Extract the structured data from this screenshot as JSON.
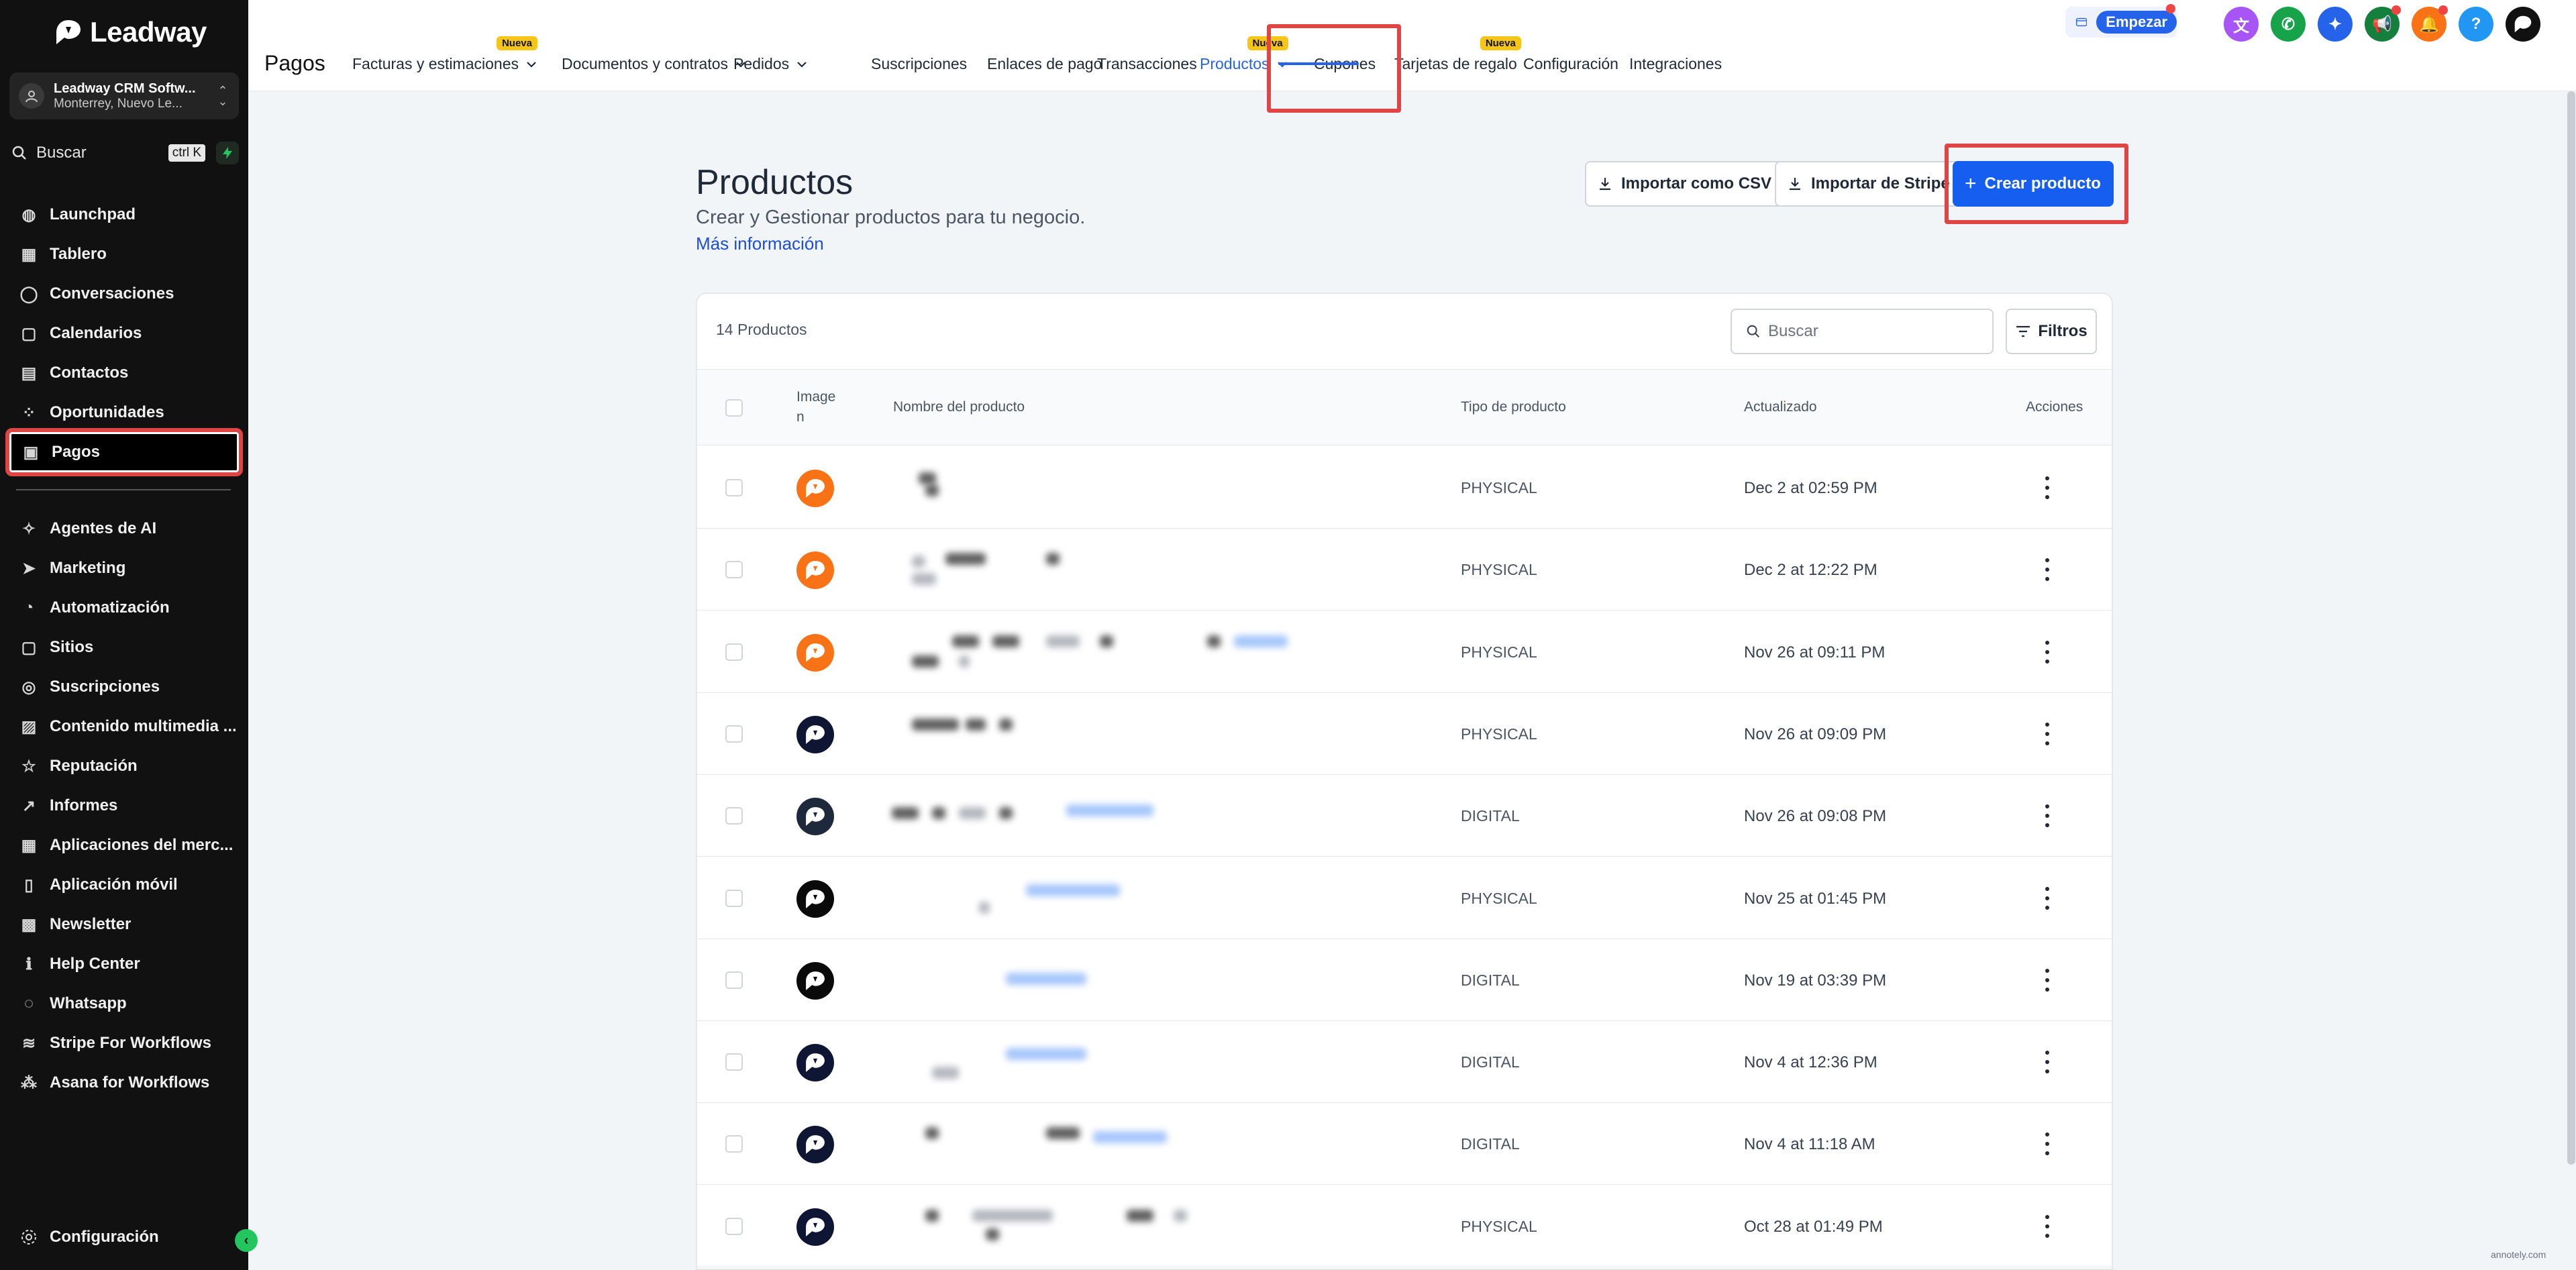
{
  "brand": {
    "name": "Leadway"
  },
  "account": {
    "name": "Leadway CRM Softw...",
    "location": "Monterrey, Nuevo Le..."
  },
  "search": {
    "label": "Buscar",
    "shortcut": "ctrl K"
  },
  "sidebar": {
    "items": [
      {
        "label": "Launchpad",
        "icon": "rocket-icon"
      },
      {
        "label": "Tablero",
        "icon": "grid-icon"
      },
      {
        "label": "Conversaciones",
        "icon": "chat-icon"
      },
      {
        "label": "Calendarios",
        "icon": "calendar-icon"
      },
      {
        "label": "Contactos",
        "icon": "contacts-icon"
      },
      {
        "label": "Oportunidades",
        "icon": "opportunities-icon"
      },
      {
        "label": "Pagos",
        "icon": "payments-icon",
        "active": true
      },
      {
        "label": "Agentes de AI",
        "icon": "sparkles-icon"
      },
      {
        "label": "Marketing",
        "icon": "send-icon"
      },
      {
        "label": "Automatización",
        "icon": "automation-icon"
      },
      {
        "label": "Sitios",
        "icon": "sites-icon"
      },
      {
        "label": "Suscripciones",
        "icon": "badge-icon"
      },
      {
        "label": "Contenido multimedia ...",
        "icon": "image-icon"
      },
      {
        "label": "Reputación",
        "icon": "star-icon"
      },
      {
        "label": "Informes",
        "icon": "trend-icon"
      },
      {
        "label": "Aplicaciones del merc...",
        "icon": "apps-icon"
      },
      {
        "label": "Aplicación móvil",
        "icon": "mobile-icon"
      },
      {
        "label": "Newsletter",
        "icon": "newsletter-icon"
      },
      {
        "label": "Help Center",
        "icon": "info-icon"
      },
      {
        "label": "Whatsapp",
        "icon": "whatsapp-icon"
      },
      {
        "label": "Stripe For Workflows",
        "icon": "stripe-icon"
      },
      {
        "label": "Asana for Workflows",
        "icon": "asana-icon"
      }
    ],
    "settings_label": "Configuración"
  },
  "header": {
    "section_title": "Pagos",
    "badge_label": "Nueva",
    "tabs": [
      {
        "label": "Facturas y estimaciones",
        "dropdown": true,
        "new": true
      },
      {
        "label": "Documentos y contratos",
        "dropdown": true
      },
      {
        "label": "Pedidos",
        "dropdown": true
      },
      {
        "label": "Suscripciones"
      },
      {
        "label": "Enlaces de pago"
      },
      {
        "label": "Transacciones"
      },
      {
        "label": "Productos",
        "dropdown": true,
        "new": true,
        "active": true
      },
      {
        "label": "Cupones"
      },
      {
        "label": "Tarjetas de regalo",
        "new": true
      },
      {
        "label": "Configuración"
      },
      {
        "label": "Integraciones"
      }
    ],
    "empezar_label": "Empezar"
  },
  "page": {
    "title": "Productos",
    "subtitle": "Crear y Gestionar productos para tu negocio.",
    "learn_more": "Más información",
    "import_csv": "Importar como CSV",
    "import_stripe": "Importar de Stripe",
    "create": "Crear producto"
  },
  "table": {
    "count_label": "14 Productos",
    "search_placeholder": "Buscar",
    "filters_label": "Filtros",
    "columns": {
      "image_1": "Image",
      "image_2": "n",
      "name": "Nombre del producto",
      "type": "Tipo de producto",
      "updated": "Actualizado",
      "actions": "Acciones"
    },
    "rows": [
      {
        "type": "PHYSICAL",
        "updated": "Dec 2 at 02:59 PM",
        "thumb_color": "#f97316"
      },
      {
        "type": "PHYSICAL",
        "updated": "Dec 2 at 12:22 PM",
        "thumb_color": "#f97316"
      },
      {
        "type": "PHYSICAL",
        "updated": "Nov 26 at 09:11 PM",
        "thumb_color": "#f97316"
      },
      {
        "type": "PHYSICAL",
        "updated": "Nov 26 at 09:09 PM",
        "thumb_color": "#0f1633"
      },
      {
        "type": "DIGITAL",
        "updated": "Nov 26 at 09:08 PM",
        "thumb_color": "#1e293b"
      },
      {
        "type": "PHYSICAL",
        "updated": "Nov 25 at 01:45 PM",
        "thumb_color": "#0a0a0a"
      },
      {
        "type": "DIGITAL",
        "updated": "Nov 19 at 03:39 PM",
        "thumb_color": "#0a0a0a"
      },
      {
        "type": "DIGITAL",
        "updated": "Nov 4 at 12:36 PM",
        "thumb_color": "#0f1633"
      },
      {
        "type": "DIGITAL",
        "updated": "Nov 4 at 11:18 AM",
        "thumb_color": "#0f1633"
      },
      {
        "type": "PHYSICAL",
        "updated": "Oct 28 at 01:49 PM",
        "thumb_color": "#0f1633"
      }
    ]
  },
  "colors": {
    "accent": "#155eef",
    "highlight": "#e04545",
    "sidebar": "#111111"
  },
  "watermark": "annotely.com"
}
